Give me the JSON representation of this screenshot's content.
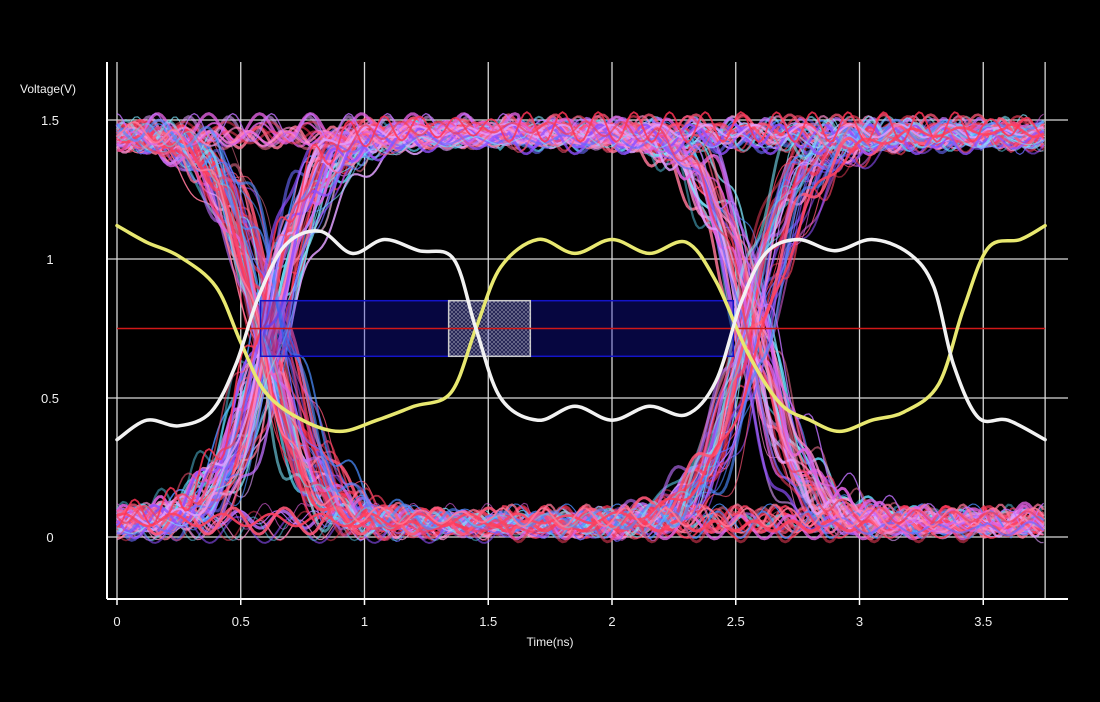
{
  "chart_data": {
    "type": "line",
    "xlabel": "Time(ns)",
    "ylabel": "Voltage(V)",
    "xlim": [
      0,
      3.75
    ],
    "ylim": [
      -0.2,
      1.7
    ],
    "xticks": [
      0,
      0.5,
      1,
      1.5,
      2,
      2.5,
      3,
      3.5
    ],
    "x_tick_labels": [
      "0",
      "0.5",
      "1",
      "1.5",
      "2",
      "2.5",
      "3",
      "3.5"
    ],
    "yticks": [
      0,
      0.5,
      1,
      1.5
    ],
    "y_tick_labels": [
      "0",
      "0.5",
      "1",
      "1.5"
    ],
    "grid": true,
    "unit_interval_ns": 1.95,
    "first_crossing_ns": 0.62,
    "decision_threshold_v": 0.75,
    "signal_levels_v": [
      0.05,
      1.45
    ],
    "reference_waveforms": [
      {
        "color": "#e8e870",
        "points": [
          [
            0,
            1.12
          ],
          [
            0.12,
            1.06
          ],
          [
            0.25,
            1.01
          ],
          [
            0.4,
            0.9
          ],
          [
            0.5,
            0.7
          ],
          [
            0.6,
            0.52
          ],
          [
            0.75,
            0.42
          ],
          [
            0.9,
            0.38
          ],
          [
            1.05,
            0.42
          ],
          [
            1.2,
            0.47
          ],
          [
            1.35,
            0.52
          ],
          [
            1.45,
            0.75
          ],
          [
            1.55,
            0.97
          ],
          [
            1.7,
            1.07
          ],
          [
            1.85,
            1.02
          ],
          [
            2.0,
            1.07
          ],
          [
            2.15,
            1.02
          ],
          [
            2.3,
            1.06
          ],
          [
            2.42,
            0.92
          ],
          [
            2.55,
            0.66
          ],
          [
            2.68,
            0.48
          ],
          [
            2.8,
            0.42
          ],
          [
            2.92,
            0.38
          ],
          [
            3.05,
            0.42
          ],
          [
            3.18,
            0.45
          ],
          [
            3.32,
            0.55
          ],
          [
            3.42,
            0.82
          ],
          [
            3.52,
            1.04
          ],
          [
            3.65,
            1.07
          ],
          [
            3.75,
            1.12
          ]
        ]
      },
      {
        "color": "#f2f2f2",
        "points": [
          [
            0,
            0.35
          ],
          [
            0.12,
            0.42
          ],
          [
            0.25,
            0.4
          ],
          [
            0.38,
            0.45
          ],
          [
            0.48,
            0.62
          ],
          [
            0.57,
            0.86
          ],
          [
            0.68,
            1.05
          ],
          [
            0.82,
            1.1
          ],
          [
            0.95,
            1.02
          ],
          [
            1.08,
            1.07
          ],
          [
            1.22,
            1.03
          ],
          [
            1.36,
            1.0
          ],
          [
            1.45,
            0.75
          ],
          [
            1.55,
            0.5
          ],
          [
            1.7,
            0.42
          ],
          [
            1.85,
            0.47
          ],
          [
            2.0,
            0.42
          ],
          [
            2.15,
            0.47
          ],
          [
            2.3,
            0.44
          ],
          [
            2.42,
            0.56
          ],
          [
            2.52,
            0.84
          ],
          [
            2.62,
            1.02
          ],
          [
            2.75,
            1.07
          ],
          [
            2.9,
            1.03
          ],
          [
            3.05,
            1.07
          ],
          [
            3.2,
            1.02
          ],
          [
            3.3,
            0.9
          ],
          [
            3.38,
            0.62
          ],
          [
            3.48,
            0.43
          ],
          [
            3.6,
            0.42
          ],
          [
            3.75,
            0.35
          ]
        ]
      }
    ],
    "mask_regions": [
      {
        "x": [
          0.58,
          2.49
        ],
        "y": [
          0.65,
          0.85
        ],
        "color": "#1414c8"
      },
      {
        "x": [
          1.34,
          1.67
        ],
        "y": [
          0.65,
          0.85
        ],
        "color": "#c8c8c8"
      }
    ],
    "trace_colors": [
      "#ff3355",
      "#ff5577",
      "#ff7799",
      "#f03c5a",
      "#ff8fd0",
      "#e060e0",
      "#c070ff",
      "#9050ff",
      "#6a6aff",
      "#4a8cff",
      "#5ad0f0",
      "#7de8ff",
      "#e0a0ff",
      "#ff4060"
    ]
  }
}
